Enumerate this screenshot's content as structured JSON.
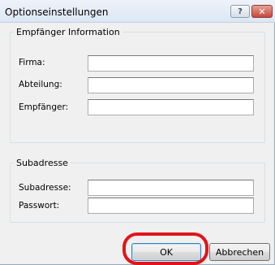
{
  "window": {
    "title": "Optionseinstellungen",
    "help_label": "?",
    "close_label": "✕"
  },
  "recipient_group": {
    "legend": "Empfänger Information",
    "fields": [
      {
        "label": "Firma:",
        "value": ""
      },
      {
        "label": "Abteilung:",
        "value": ""
      },
      {
        "label": "Empfänger:",
        "value": ""
      }
    ]
  },
  "subaddress_group": {
    "legend": "Subadresse",
    "fields": [
      {
        "label": "Subadresse:",
        "value": ""
      },
      {
        "label": "Passwort:",
        "value": ""
      }
    ]
  },
  "buttons": {
    "ok_label": "OK",
    "cancel_label": "Abbrechen"
  },
  "colors": {
    "highlight": "#e2141b",
    "close_button": "#c6463a",
    "dialog_background": "#f0f0f0"
  }
}
